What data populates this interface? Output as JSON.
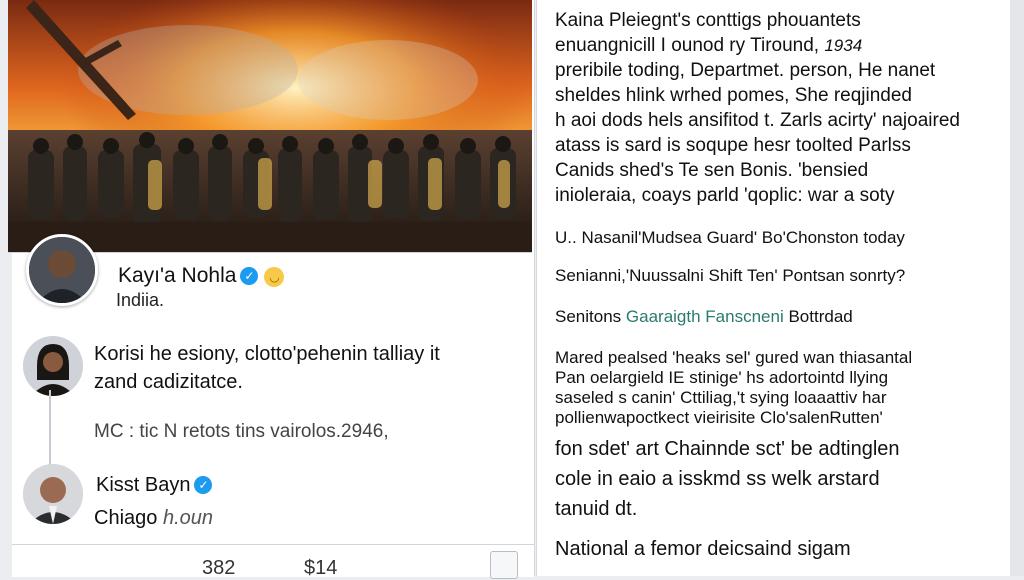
{
  "post": {
    "author_name": "Kayı'a Nohla",
    "author_location": "Indiia.",
    "colors": {
      "accent": "#1d9bf0",
      "emoji": "#f7c948"
    }
  },
  "replies": [
    {
      "text_line1": "Korisi he esiony, clotto'pehenin talliay it",
      "text_line2": "zand cadizitatce.",
      "meta": "MC : tic N retots tins vairolos.2946,"
    },
    {
      "name": "Kisst Bayn",
      "location_prefix": "Chiago",
      "location_suffix": "h.oun"
    }
  ],
  "stats": {
    "count_a": "382",
    "count_b": "$14"
  },
  "article": {
    "paragraph1": [
      "Kaina Pleiegnt's conttigs phouantets",
      "enuangnicill  I ounod ry Tiround,",
      "preribile toding, Departmet. person, He nanet",
      "sheldes hlink wrhed pomes, She reqjinded",
      "h aoi dods hels ansifitod t. Zarls acirty' najoaired",
      "atass is sard is soqupe hesr toolted Parlss",
      "Canids shed's Te sen Bonis. 'bensied",
      "inioleraia, coays parld 'qoplic: war a soty"
    ],
    "paragraph1_year": "1934",
    "line1": "U.. Nasanil'Mudsea Guard' Bo'Chonston today",
    "line2": "Senianni,'Nuussalni Shift Ten' Pontsan sonrty?",
    "line3_prefix": "Senitons",
    "line3_highlight": "Gaaraigth Fanscneni",
    "line3_suffix": "Bottrdad",
    "paragraph2": [
      "Mared pealsed 'heaks sel' gured  wan thiasantal",
      "Pan oelargield IE stinige' hs adortointd llying",
      "saseled s canin' Cttiliag,'t sying loaaattiv har",
      "pollienwapoctkect vieirisite Clo'salenRutten'"
    ],
    "paragraph3": [
      "fon sdet' art  Chainnde sct' be adtinglen",
      "cole in eaio  a isskmd ss welk arstard",
      "tanuid dt."
    ],
    "footer": "National a femor deicsaind sigam",
    "colors": {
      "highlight": "#2a7a70"
    }
  }
}
